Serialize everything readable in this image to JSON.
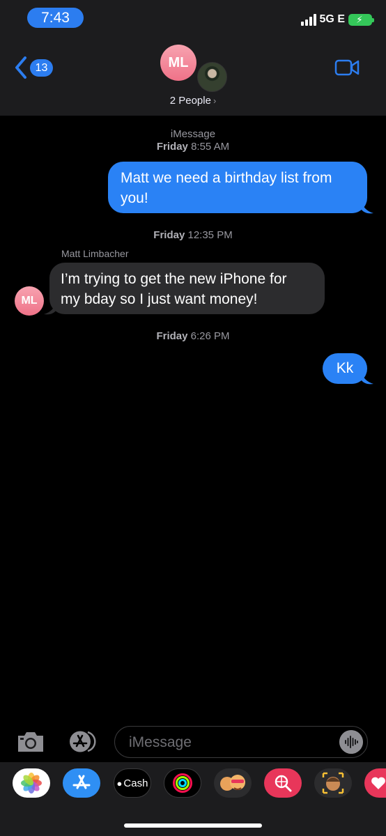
{
  "status_bar": {
    "time": "7:43",
    "network": "5G E",
    "battery_state": "charging"
  },
  "header": {
    "back_badge": "13",
    "group_initials": "ML",
    "people_label": "2 People",
    "chevron_glyph": "›"
  },
  "conversation": {
    "service_label": "iMessage",
    "messages": [
      {
        "timestamp_day": "Friday",
        "timestamp_time": "8:55 AM",
        "direction": "outgoing",
        "lines": [
          "Matt we need a birthday list from",
          "you!"
        ]
      },
      {
        "timestamp_day": "Friday",
        "timestamp_time": "12:35 PM",
        "direction": "incoming",
        "sender": "Matt Limbacher",
        "sender_initials": "ML",
        "lines": [
          "I’m trying to get the new iPhone for",
          "my bday so I just want money!"
        ]
      },
      {
        "timestamp_day": "Friday",
        "timestamp_time": "6:26 PM",
        "direction": "outgoing",
        "lines": [
          "Kk"
        ]
      }
    ]
  },
  "composer": {
    "placeholder": "iMessage"
  },
  "app_drawer": {
    "cash_label": "Cash",
    "apps": [
      "photos-icon",
      "app-store-icon",
      "apple-cash-icon",
      "activity-icon",
      "memoji-stickers-icon",
      "web-search-icon",
      "animoji-icon",
      "digital-touch-icon"
    ]
  },
  "colors": {
    "accent": "#2c7df0",
    "outgoing_bubble": "#2a82f5",
    "incoming_bubble": "#2c2c2e",
    "header_bg": "#1c1c1e",
    "avatar_pink": "#ef7288",
    "battery_green": "#34c759"
  }
}
